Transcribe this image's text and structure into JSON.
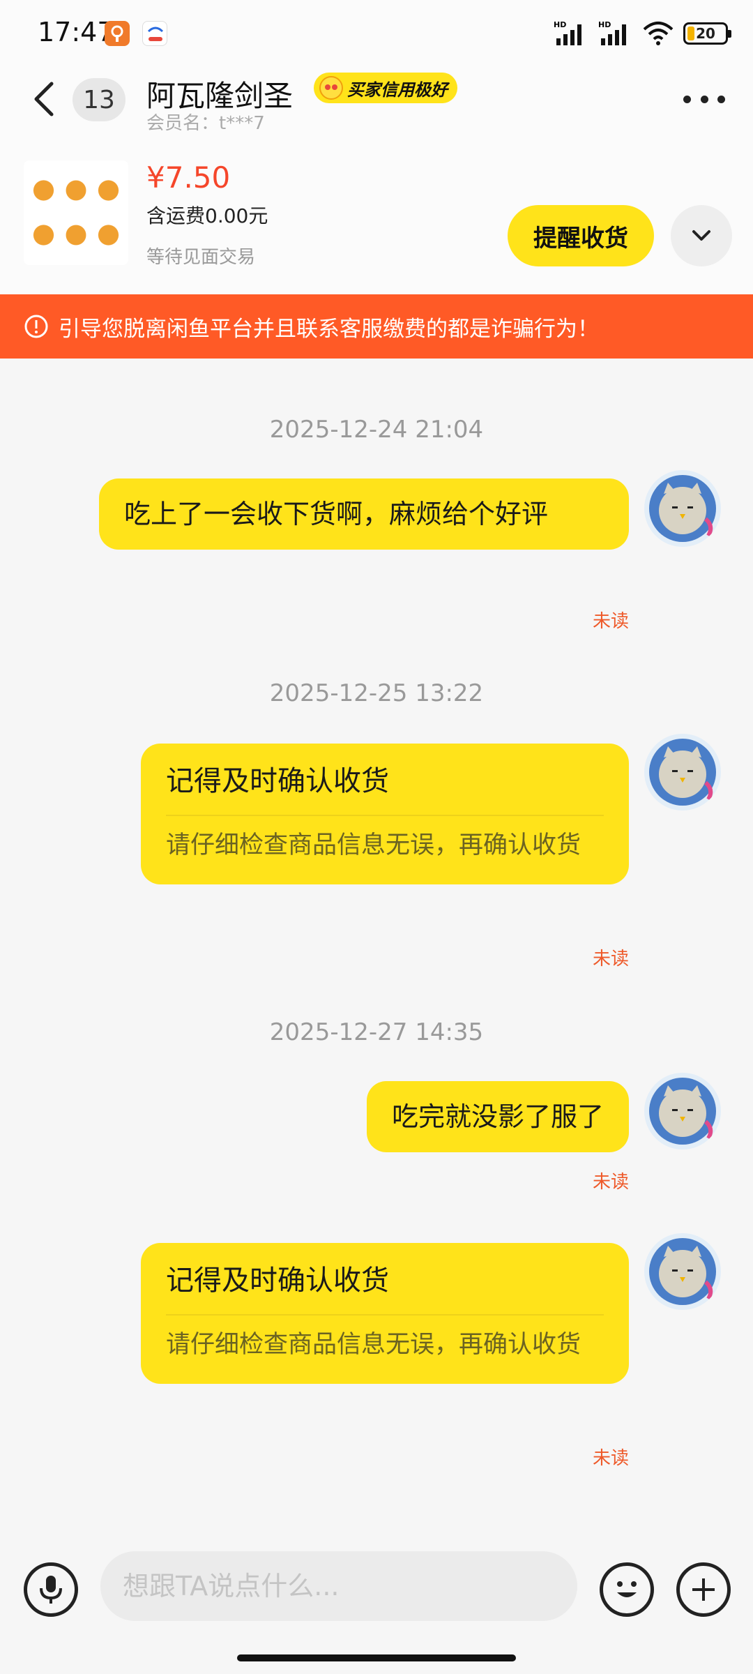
{
  "status_bar": {
    "time": "17:47",
    "signal1_label": "HD",
    "signal2_label": "HD",
    "battery_level": "20",
    "icons": [
      "app-notification-icon",
      "cloud-app-icon",
      "signal-icon",
      "signal-icon",
      "wifi-icon",
      "battery-icon"
    ]
  },
  "header": {
    "unread_count": "13",
    "seller_name": "阿瓦隆剑圣",
    "credit_badge": "买家信用极好",
    "member_name": "会员名：t***7"
  },
  "product": {
    "price": "¥7.50",
    "shipping": "含运费0.00元",
    "status": "等待见面交易",
    "remind_button": "提醒收货"
  },
  "warning": {
    "text": "引导您脱离闲鱼平台并且联系客服缴费的都是诈骗行为！"
  },
  "messages": [
    {
      "timestamp": "2025-12-24 21:04",
      "type": "text",
      "text": "吃上了一会收下货啊，麻烦给个好评",
      "status": "未读"
    },
    {
      "timestamp": "2025-12-25 13:22",
      "type": "card",
      "title": "记得及时确认收货",
      "body": "请仔细检查商品信息无误，再确认收货",
      "status": "未读"
    },
    {
      "timestamp": "2025-12-27 14:35",
      "type": "text",
      "text": "吃完就没影了服了",
      "status": "未读"
    },
    {
      "type": "card",
      "title": "记得及时确认收货",
      "body": "请仔细检查商品信息无误，再确认收货",
      "status": "未读"
    }
  ],
  "input": {
    "placeholder": "想跟TA说点什么..."
  },
  "colors": {
    "accent_yellow": "#ffe31a",
    "warning_orange": "#ff5a26",
    "price_red": "#f5462a",
    "unread_red": "#ee5a2a"
  }
}
